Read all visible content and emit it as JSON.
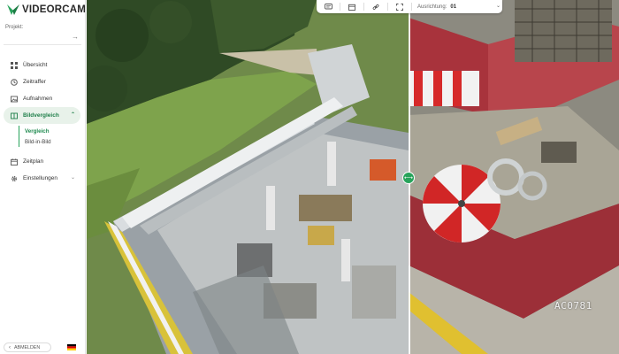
{
  "brand": {
    "name": "VIDEORCAM",
    "accent": "#27a35b"
  },
  "sidebar": {
    "project_label": "Projekt:",
    "items": [
      {
        "label": "Übersicht",
        "icon": "grid-icon"
      },
      {
        "label": "Zeitraffer",
        "icon": "timelapse-icon"
      },
      {
        "label": "Aufnahmen",
        "icon": "image-icon"
      },
      {
        "label": "Bildvergleich",
        "icon": "compare-icon",
        "active": true,
        "children": [
          {
            "label": "Vergleich",
            "active": true
          },
          {
            "label": "Bild-in-Bild"
          }
        ]
      },
      {
        "label": "Zeitplan",
        "icon": "calendar-icon"
      },
      {
        "label": "Einstellungen",
        "icon": "gear-icon"
      }
    ],
    "logout_label": "ABMELDEN",
    "language": "de"
  },
  "toolbar": {
    "alignment_label": "Ausrichtung:",
    "alignment_value": "01"
  },
  "viewer": {
    "watermark": "AC0781"
  }
}
